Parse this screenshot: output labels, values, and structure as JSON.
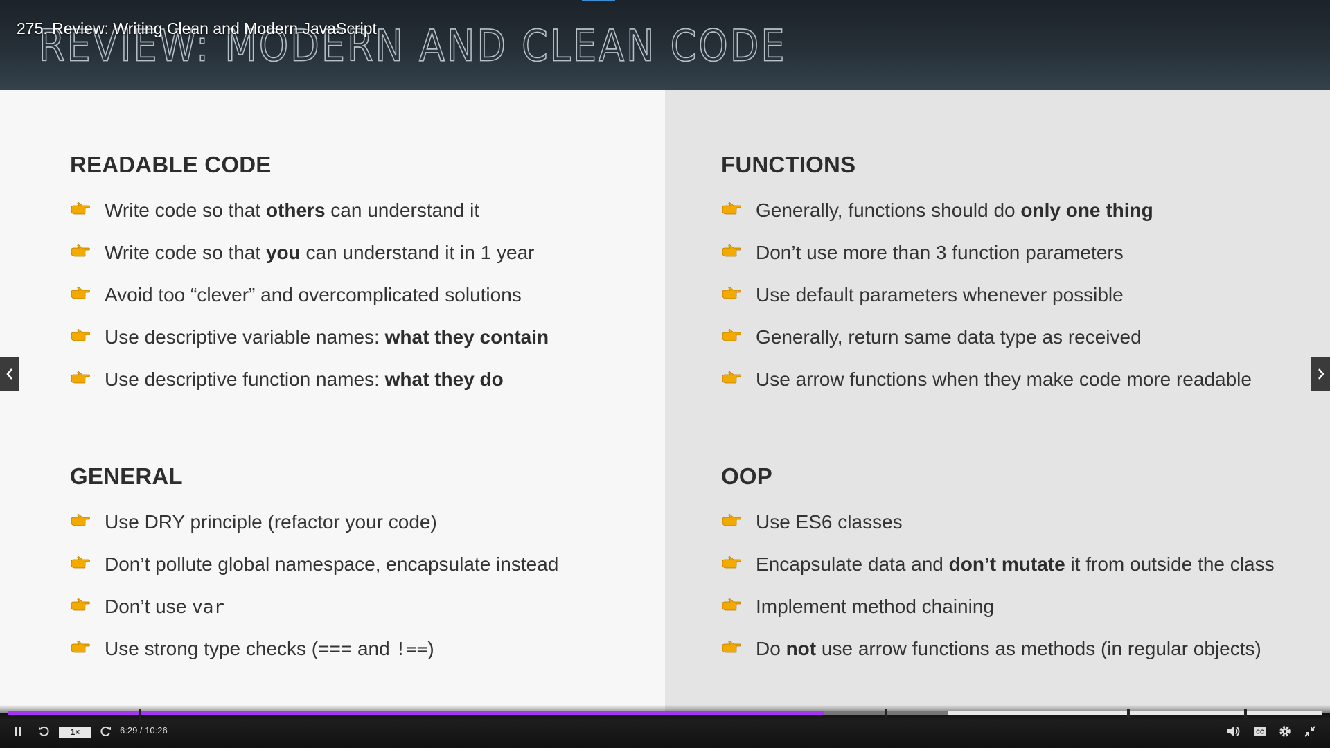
{
  "header": {
    "slide_title": "REVIEW: MODERN AND CLEAN CODE",
    "video_title": "275. Review: Writing Clean and Modern JavaScript",
    "accent_color": "#3a8fd4"
  },
  "sections": {
    "readable": {
      "heading": "READABLE CODE",
      "items": [
        {
          "pre": "Write code so that ",
          "bold": "others",
          "post": " can understand it"
        },
        {
          "pre": "Write code so that ",
          "bold": "you",
          "post": " can understand it in 1 year"
        },
        {
          "pre": "Avoid too “clever” and overcomplicated solutions",
          "bold": "",
          "post": ""
        },
        {
          "pre": "Use descriptive variable names: ",
          "bold": "what they contain",
          "post": ""
        },
        {
          "pre": "Use descriptive function names: ",
          "bold": "what they do",
          "post": ""
        }
      ]
    },
    "general": {
      "heading": "GENERAL",
      "items": [
        {
          "pre": "Use DRY principle (refactor your code)",
          "code": "",
          "post": ""
        },
        {
          "pre": "Don’t pollute global namespace, encapsulate instead",
          "code": "",
          "post": ""
        },
        {
          "pre": "Don’t use ",
          "code": "var",
          "post": ""
        },
        {
          "pre": "Use strong type checks (=== and ",
          "code": "!==",
          "post": ")"
        }
      ]
    },
    "functions": {
      "heading": "FUNCTIONS",
      "items": [
        {
          "pre": "Generally, functions should do ",
          "bold": "only one thing",
          "post": ""
        },
        {
          "pre": "Don’t use more than 3 function parameters",
          "bold": "",
          "post": ""
        },
        {
          "pre": "Use default parameters whenever possible",
          "bold": "",
          "post": ""
        },
        {
          "pre": "Generally, return same data type as received",
          "bold": "",
          "post": ""
        },
        {
          "pre": "Use arrow functions when they make code more readable",
          "bold": "",
          "post": ""
        }
      ]
    },
    "oop": {
      "heading": "OOP",
      "items": [
        {
          "pre": "Use ES6 classes",
          "bold": "",
          "post": ""
        },
        {
          "pre": "Encapsulate data and ",
          "bold": "don’t mutate",
          "post": " it from outside the class"
        },
        {
          "pre": "Implement method chaining",
          "bold": "",
          "post": ""
        },
        {
          "pre": "Do ",
          "bold": "not",
          "post": " use arrow functions as methods (in regular objects)"
        }
      ]
    }
  },
  "bullet_icon": "pointing-hand-icon",
  "bullet_color": "#f2a900",
  "player": {
    "speed": "1×",
    "current_time": "6:29",
    "duration": "10:26",
    "time_separator": " / ",
    "played_fraction": 0.6215,
    "buffered_fraction": 0.715,
    "chapter_marks": [
      0.1,
      0.668,
      0.853,
      0.942
    ],
    "played_color": "#a435f0",
    "icons": [
      "pause-icon",
      "rewind-icon",
      "forward-icon",
      "volume-icon",
      "captions-icon",
      "settings-icon",
      "exit-fullscreen-icon"
    ]
  },
  "nav": {
    "prev_icon": "chevron-left-icon",
    "next_icon": "chevron-right-icon"
  }
}
